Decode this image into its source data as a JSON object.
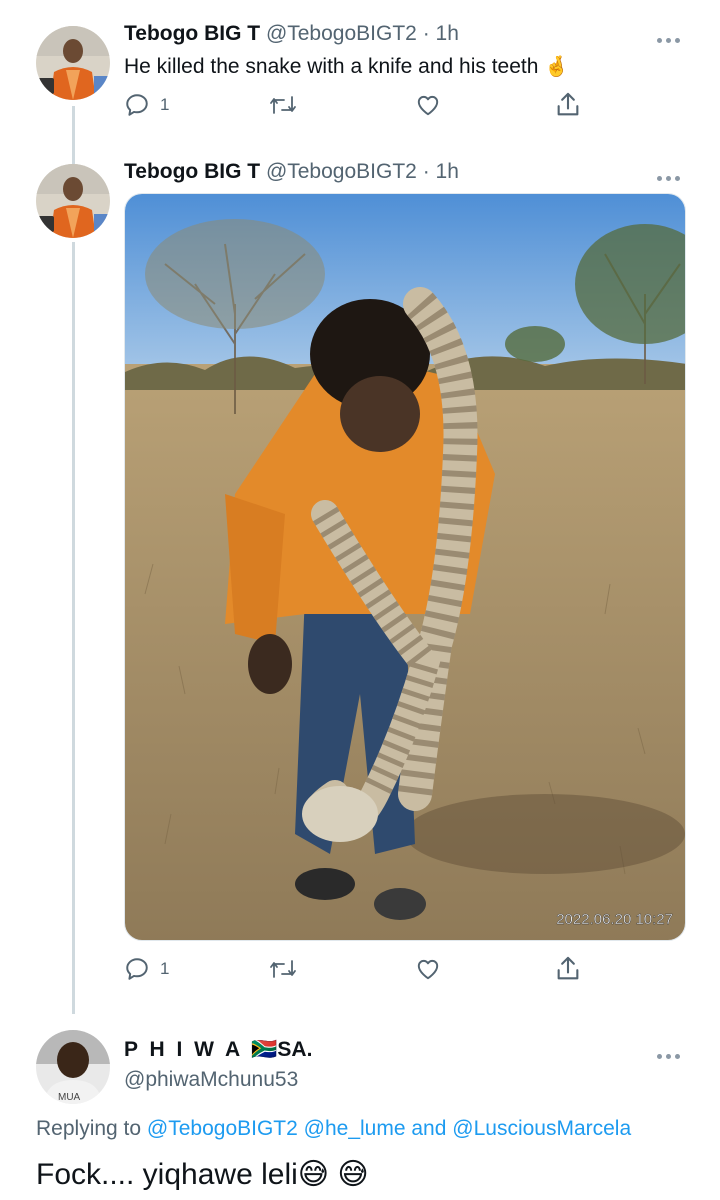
{
  "tweet1": {
    "display_name": "Tebogo BIG T",
    "handle": "@TebogoBIGT2",
    "separator": "·",
    "time": "1h",
    "text": "He killed the snake with a knife and his teeth",
    "emoji": "🤞",
    "reply_count": "1"
  },
  "tweet2": {
    "display_name": "Tebogo BIG T",
    "handle": "@TebogoBIGT2",
    "separator": "·",
    "time": "1h",
    "photo_timestamp": "2022.06.20 10:27",
    "reply_count": "1"
  },
  "reply": {
    "display_name": "P H I W A",
    "flag": "🇿🇦",
    "name_suffix": "SA",
    "apple": "",
    "name_end": ".",
    "handle": "@phiwaMchunu53",
    "replying_prefix": "Replying to",
    "mention1": "@TebogoBIGT2",
    "mention2": "@he_lume",
    "and_word": "and",
    "mention3": "@LusciousMarcela",
    "text": "Fock.... yiqhawe leli",
    "emoji": "😅 😅"
  },
  "colors": {
    "link": "#1d9bf0",
    "secondary_text": "#536471",
    "thread_line": "#cfd9de"
  },
  "icons": [
    "reply-icon",
    "retweet-icon",
    "like-icon",
    "share-icon",
    "more-icon"
  ]
}
